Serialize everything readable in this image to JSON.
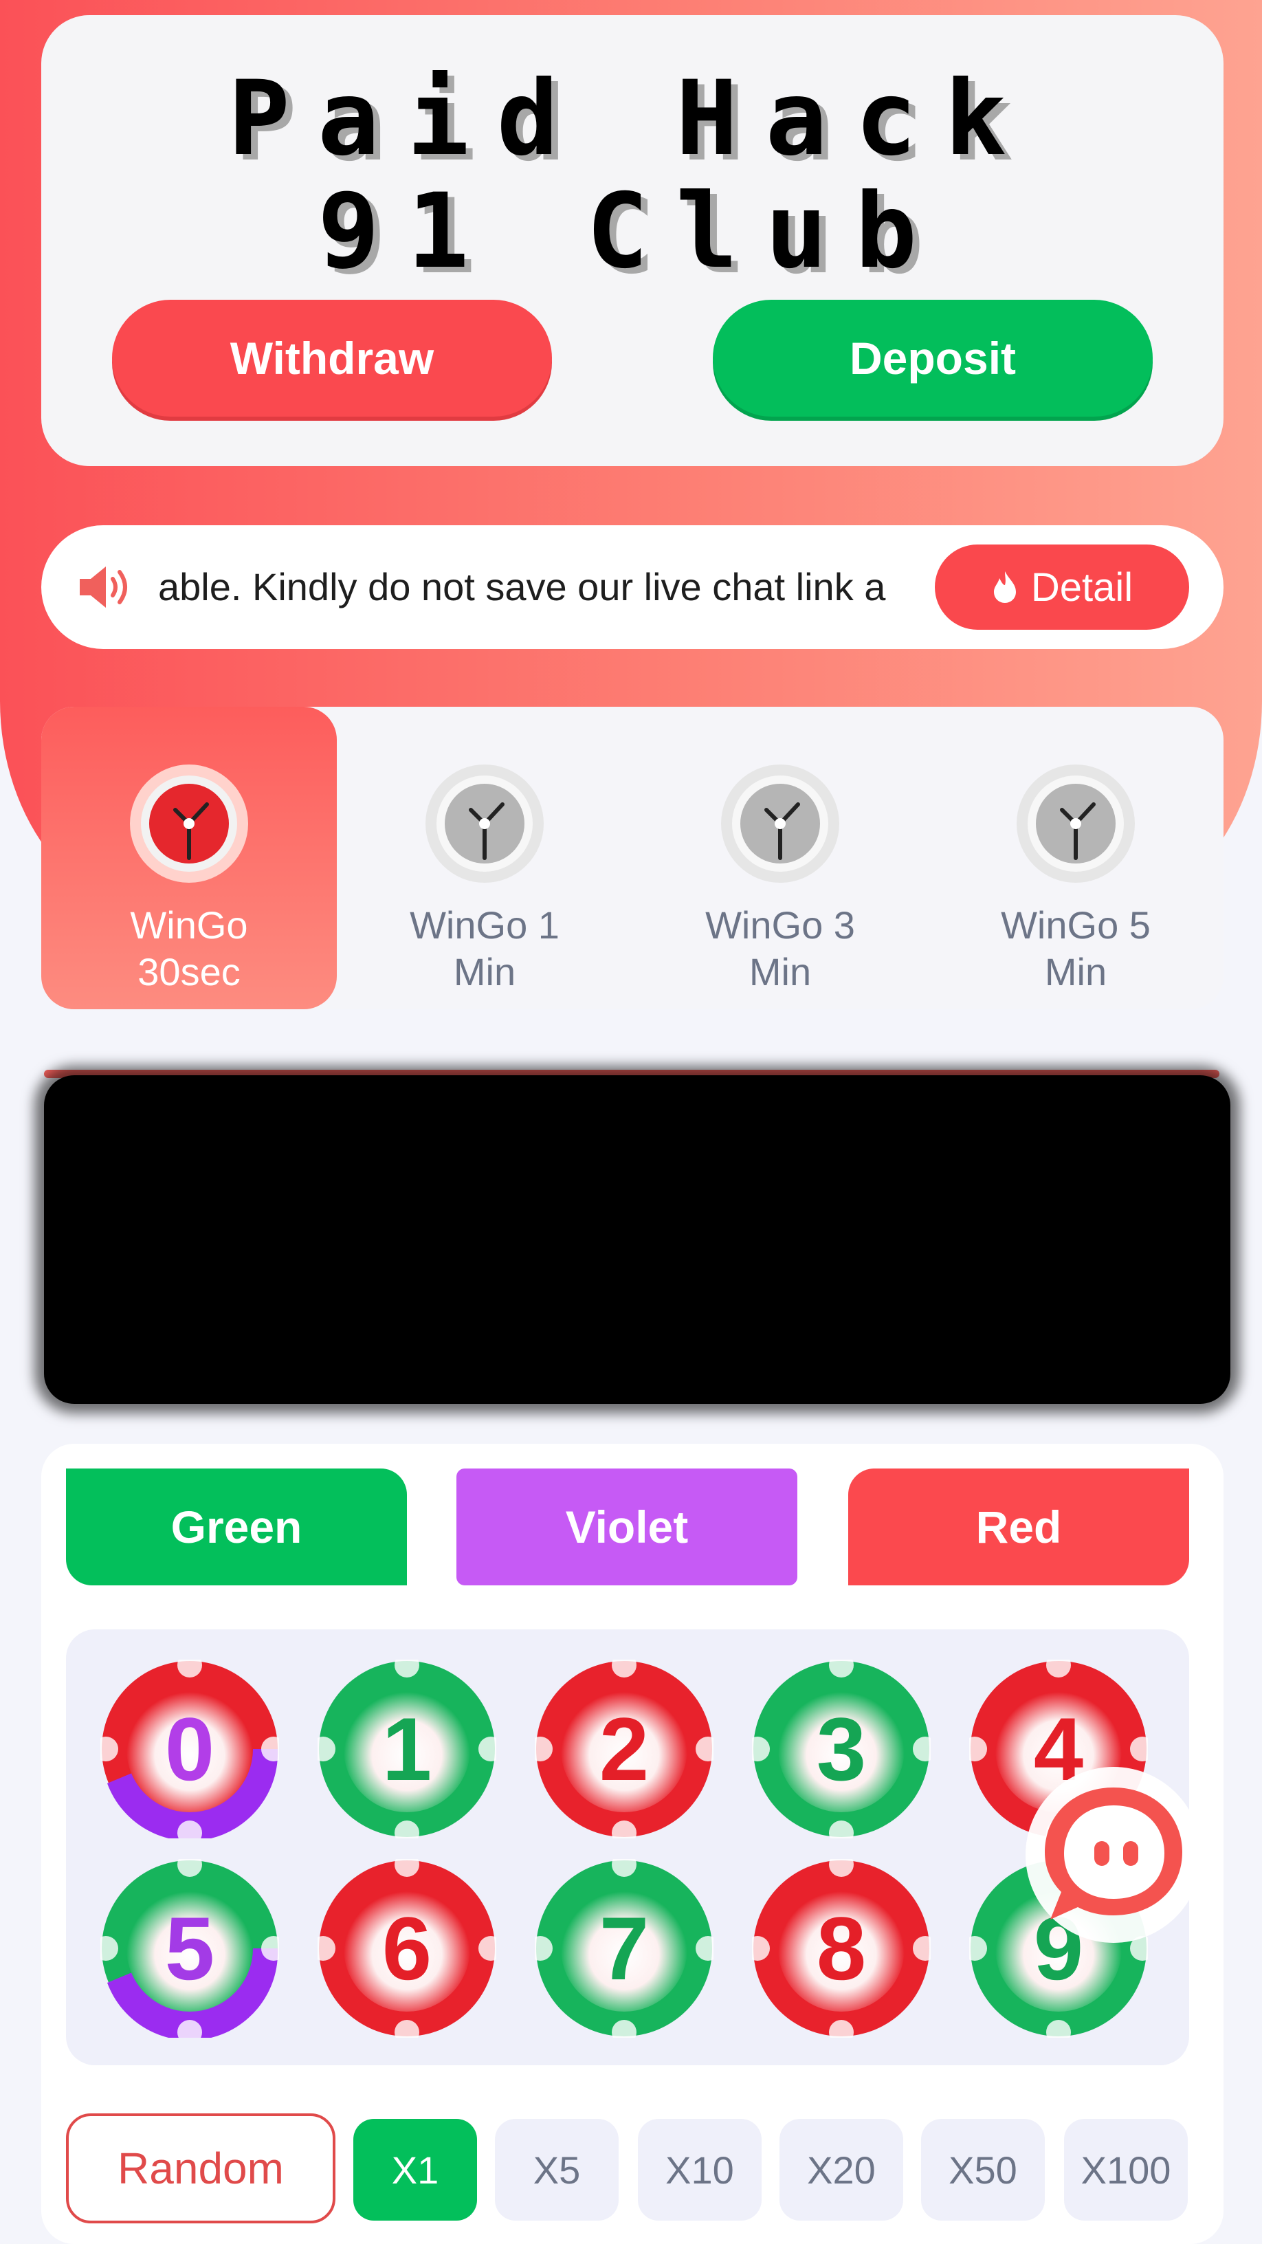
{
  "header": {
    "title_line1": "Paid Hack",
    "title_line2": "91 Club",
    "withdraw_label": "Withdraw",
    "deposit_label": "Deposit"
  },
  "notice": {
    "text": "able. Kindly do not save our live chat link a",
    "detail_label": "Detail"
  },
  "tabs": [
    {
      "line1": "WinGo",
      "line2": "30sec",
      "active": true
    },
    {
      "line1": "WinGo 1",
      "line2": "Min",
      "active": false
    },
    {
      "line1": "WinGo 3",
      "line2": "Min",
      "active": false
    },
    {
      "line1": "WinGo 5",
      "line2": "Min",
      "active": false
    }
  ],
  "colors": {
    "green": "#03bf5b",
    "violet": "#c65af5",
    "red": "#fb494e",
    "accent": "#fa494f"
  },
  "color_buttons": {
    "green": "Green",
    "violet": "Violet",
    "red": "Red"
  },
  "numbers": [
    {
      "n": "0",
      "color": "red-violet"
    },
    {
      "n": "1",
      "color": "green"
    },
    {
      "n": "2",
      "color": "red"
    },
    {
      "n": "3",
      "color": "green"
    },
    {
      "n": "4",
      "color": "red"
    },
    {
      "n": "5",
      "color": "green-violet"
    },
    {
      "n": "6",
      "color": "red"
    },
    {
      "n": "7",
      "color": "green"
    },
    {
      "n": "8",
      "color": "red"
    },
    {
      "n": "9",
      "color": "green"
    }
  ],
  "multipliers": {
    "random_label": "Random",
    "options": [
      "X1",
      "X5",
      "X10",
      "X20",
      "X50",
      "X100"
    ],
    "selected": "X1"
  },
  "icons": {
    "notice": "speaker-icon",
    "detail": "fire-icon",
    "tab": "clock-icon",
    "support": "chat-support-icon"
  }
}
